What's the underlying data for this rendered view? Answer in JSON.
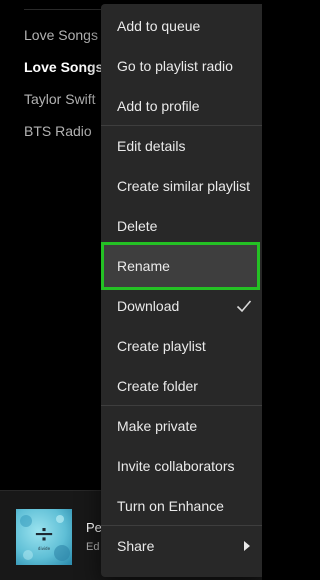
{
  "sidebar": {
    "playlists": [
      {
        "label": "Love Songs"
      },
      {
        "label": "Love Songs"
      },
      {
        "label": "Taylor Swift"
      },
      {
        "label": "BTS Radio"
      }
    ]
  },
  "now_playing": {
    "title": "Pe",
    "artist": "Ed",
    "album_symbol": "÷",
    "album_text": "divide"
  },
  "context_menu": {
    "items": [
      {
        "label": "Add to queue"
      },
      {
        "label": "Go to playlist radio"
      },
      {
        "label": "Add to profile"
      },
      {
        "label": "Edit details"
      },
      {
        "label": "Create similar playlist"
      },
      {
        "label": "Delete"
      },
      {
        "label": "Rename"
      },
      {
        "label": "Download",
        "checked": true
      },
      {
        "label": "Create playlist"
      },
      {
        "label": "Create folder"
      },
      {
        "label": "Make private"
      },
      {
        "label": "Invite collaborators"
      },
      {
        "label": "Turn on Enhance"
      },
      {
        "label": "Share"
      }
    ],
    "download_icon": "check-icon",
    "share_icon": "caret-right-icon"
  },
  "colors": {
    "menu_bg": "#282828",
    "highlight_border": "#24c124",
    "sidebar_bg": "#000000",
    "player_bg": "#181818"
  }
}
